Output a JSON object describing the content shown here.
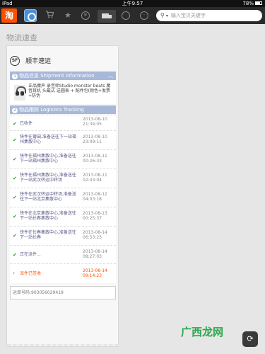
{
  "status_bar": {
    "device": "iPad",
    "time": "上午9:57",
    "battery": "78%"
  },
  "app": {
    "logo_text": "淘",
    "search_placeholder": "输入宝贝关键字",
    "toolbar_icons": [
      "avatar-icon",
      "cart-icon",
      "star-icon",
      "yen-icon",
      "truck-icon",
      "cycle-icon",
      "clock-icon",
      "search-icon"
    ]
  },
  "page": {
    "title": "物流速查"
  },
  "courier": {
    "logo_text": "SF",
    "name": "顺丰速运"
  },
  "shipment_info": {
    "number": "1",
    "header": "物品信息 Shipment Information",
    "product_desc": "正品魔声 录音师Studio monster beats 魔音耳机 头戴式 送圆表 + 配件包(颜色+发票+防伪"
  },
  "tracking": {
    "number": "2",
    "header": "物品跟踪 Logistics Tracking",
    "events": [
      {
        "text": "已收件",
        "time": "2013-08-10 21:34:05"
      },
      {
        "text": "快件在莆田,准备送往下一站福州集散中心",
        "time": "2013-08-10 23:09:11"
      },
      {
        "text": "快件在福州集散中心,准备送往下一站福州集散中心",
        "time": "2013-08-11 00:26:33"
      },
      {
        "text": "快件在福州集散中心,准备送往下一站武汉转运中转场",
        "time": "2013-08-11 02:43:04"
      },
      {
        "text": "快件在武汉转运中转场,准备送往下一站北京集散中心",
        "time": "2013-08-12 04:03:18"
      },
      {
        "text": "快件在北京集散中心,准备送往下一站长春集散中心",
        "time": "2013-08-13 00:25:37"
      },
      {
        "text": "快件在长春集散中心,准备送往下一站长春",
        "time": "2013-08-14 06:53:23"
      },
      {
        "text": "正在派件...",
        "time": "2013-08-14 08:27:03"
      },
      {
        "text": "派件已签收",
        "time": "2013-08-14 09:14:23"
      }
    ]
  },
  "waybill": {
    "text": "运单号码:903056029419"
  },
  "watermark": {
    "text": "广西龙网"
  }
}
